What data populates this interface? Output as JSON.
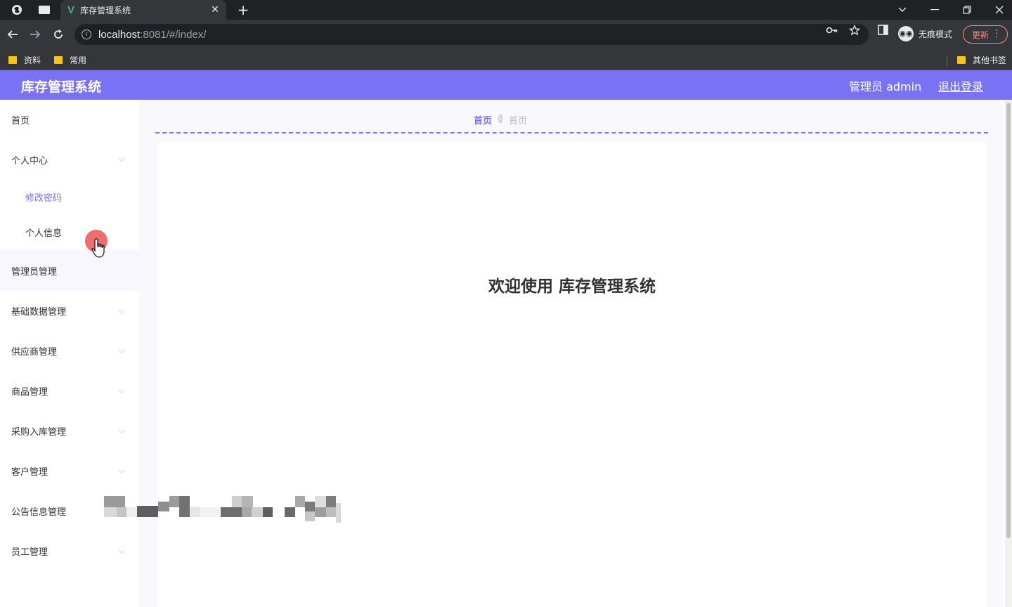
{
  "browser": {
    "tab_title": "库存管理系统",
    "tab_favicon": "V",
    "url_host": "localhost",
    "url_rest": ":8081/#/index/",
    "incognito_label": "无痕模式",
    "update_label": "更新",
    "bookmarks": [
      {
        "label": "资料"
      },
      {
        "label": "常用"
      }
    ],
    "other_bookmarks": "其他书签"
  },
  "header": {
    "title": "库存管理系统",
    "admin_label": "管理员 admin",
    "logout_label": "退出登录",
    "accent_color": "#7a72f5"
  },
  "sidebar": {
    "items": [
      {
        "label": "首页"
      },
      {
        "label": "个人中心"
      },
      {
        "label": "修改密码"
      },
      {
        "label": "个人信息"
      },
      {
        "label": "管理员管理"
      },
      {
        "label": "基础数据管理"
      },
      {
        "label": "供应商管理"
      },
      {
        "label": "商品管理"
      },
      {
        "label": "采购入库管理"
      },
      {
        "label": "客户管理"
      },
      {
        "label": "公告信息管理"
      },
      {
        "label": "员工管理"
      }
    ]
  },
  "main": {
    "breadcrumb": {
      "home": "首页",
      "current": "首页"
    },
    "welcome": "欢迎使用 库存管理系统"
  }
}
